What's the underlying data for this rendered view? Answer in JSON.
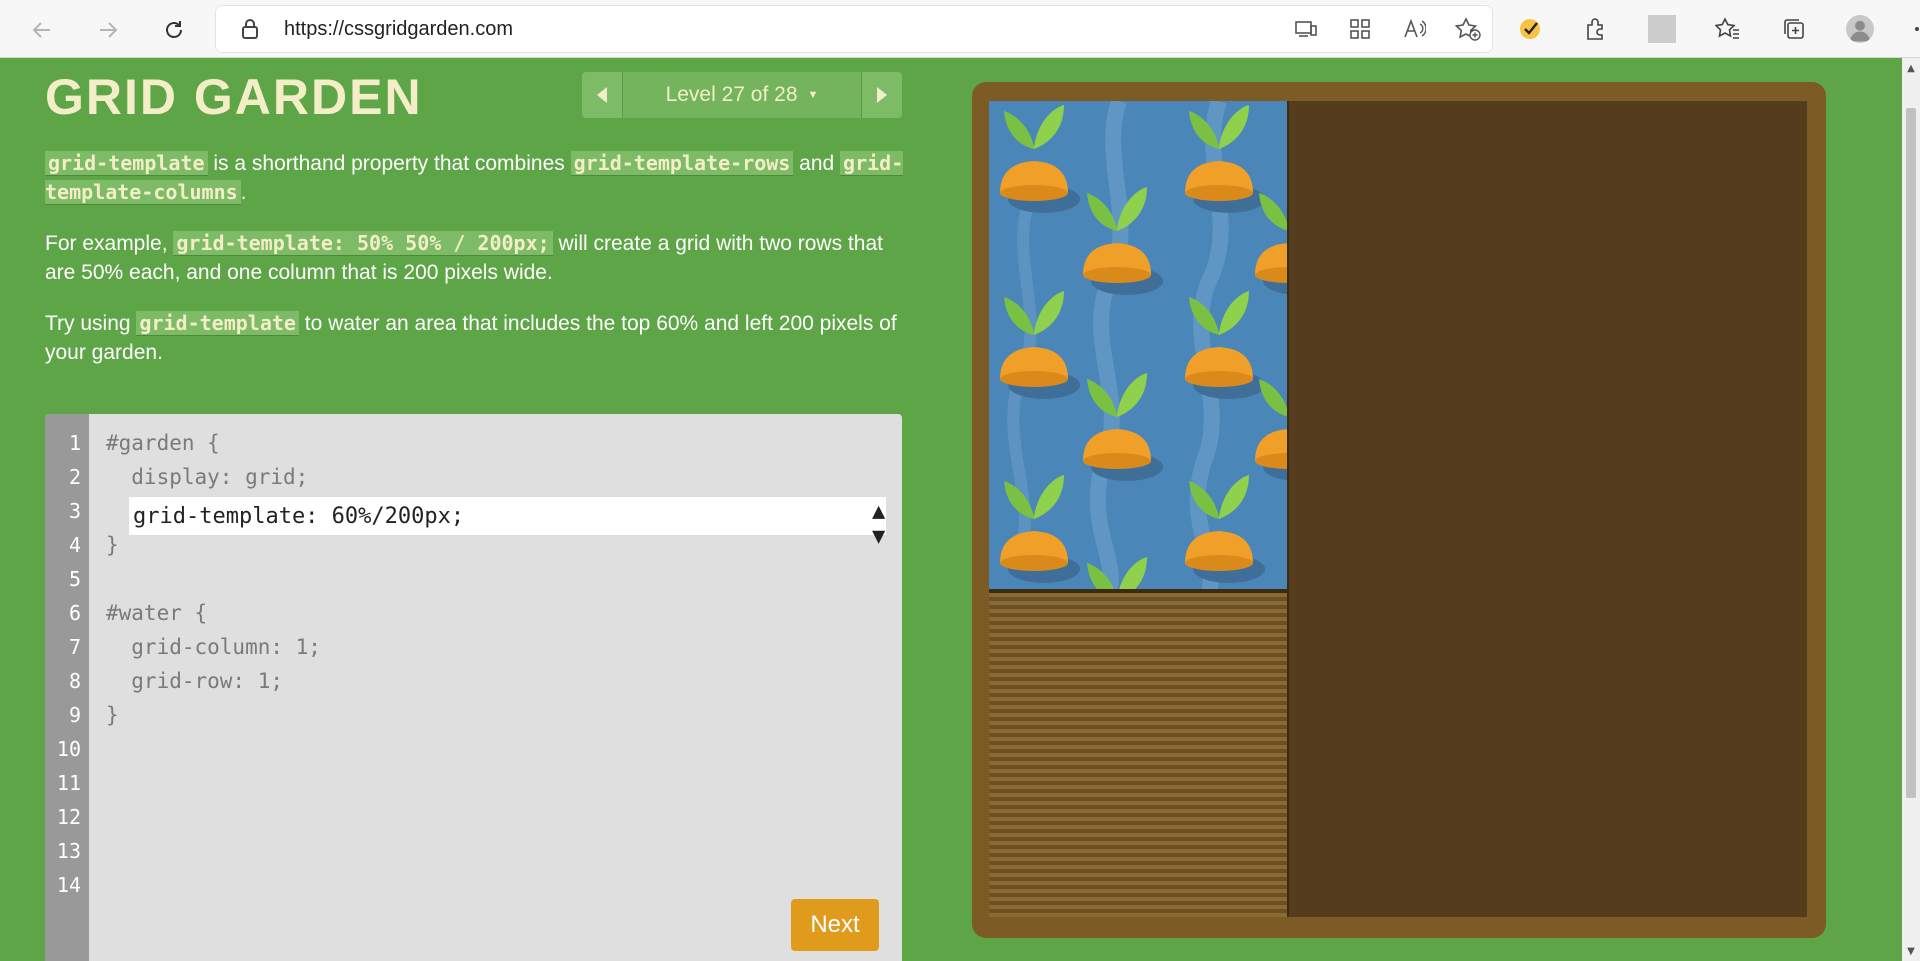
{
  "browser": {
    "url": "https://cssgridgarden.com"
  },
  "game": {
    "title": "GRID GARDEN",
    "level_label": "Level 27 of 28",
    "instructions": {
      "p1": {
        "code1": "grid-template",
        "text1": " is a shorthand property that combines ",
        "code2": "grid-template-rows",
        "text2": " and ",
        "code3": "grid-template-columns",
        "text3": "."
      },
      "p2": {
        "text1": "For example, ",
        "code1": "grid-template: 50% 50% / 200px;",
        "text2": " will create a grid with two rows that are 50% each, and one column that is 200 pixels wide."
      },
      "p3": {
        "text1": "Try using ",
        "code1": "grid-template",
        "text2": " to water an area that includes the top 60% and left 200 pixels of your garden."
      }
    },
    "editor": {
      "line_numbers": [
        "1",
        "2",
        "3",
        "4",
        "5",
        "6",
        "7",
        "8",
        "9",
        "10",
        "11",
        "12",
        "13",
        "14"
      ],
      "line1": "#garden {",
      "line2": "  display: grid;",
      "line4": "}",
      "line6": "#water {",
      "line7": "  grid-column: 1;",
      "line8": "  grid-row: 1;",
      "line9": "}",
      "input_value": "grid-template: 60%/200px;"
    },
    "next_label": "Next"
  },
  "colors": {
    "page_bg": "#5ea547",
    "water": "#4a86b8",
    "soil": "#543c1d",
    "carrot": "#f0a028",
    "leaf": "#7ac143",
    "next_button": "#e09b1d"
  }
}
